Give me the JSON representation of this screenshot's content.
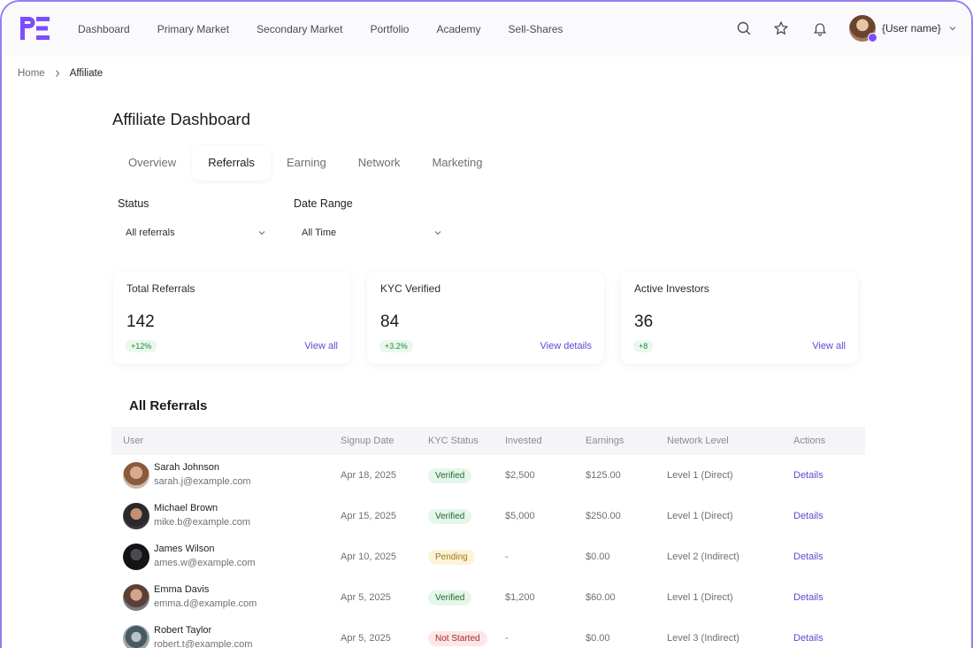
{
  "nav": {
    "items": [
      "Dashboard",
      "Primary Market",
      "Secondary Market",
      "Portfolio",
      "Academy",
      "Sell-Shares"
    ],
    "user_name": "{User name}",
    "icons": [
      "search-icon",
      "star-icon",
      "bell-icon"
    ]
  },
  "breadcrumb": {
    "home": "Home",
    "current": "Affiliate"
  },
  "page_title": "Affiliate Dashboard",
  "tabs": [
    "Overview",
    "Referrals",
    "Earning",
    "Network",
    "Marketing"
  ],
  "active_tab": "Referrals",
  "filters": {
    "status": {
      "label": "Status",
      "value": "All referrals"
    },
    "date_range": {
      "label": "Date Range",
      "value": "All Time"
    }
  },
  "stats": [
    {
      "label": "Total Referrals",
      "value": "142",
      "change": "+12%",
      "link": "View all"
    },
    {
      "label": "KYC Verified",
      "value": "84",
      "change": "+3.2%",
      "link": "View details"
    },
    {
      "label": "Active Investors",
      "value": "36",
      "change": "+8",
      "link": "View all"
    }
  ],
  "referrals": {
    "title": "All Referrals",
    "columns": [
      "User",
      "Signup Date",
      "KYC Status",
      "Invested",
      "Earnings",
      "Network Level",
      "Actions"
    ],
    "rows": [
      {
        "name": "Sarah Johnson",
        "email": "sarah.j@example.com",
        "date": "Apr 18, 2025",
        "kyc": "Verified",
        "invested": "$2,500",
        "earnings": "$125.00",
        "level": "Level 1 (Direct)",
        "action": "Details"
      },
      {
        "name": "Michael Brown",
        "email": "mike.b@example.com",
        "date": "Apr 15, 2025",
        "kyc": "Verified",
        "invested": "$5,000",
        "earnings": "$250.00",
        "level": "Level 1 (Direct)",
        "action": "Details"
      },
      {
        "name": "James Wilson",
        "email": "ames.w@example.com",
        "date": "Apr 10, 2025",
        "kyc": "Pending",
        "invested": "-",
        "earnings": "$0.00",
        "level": "Level 2 (Indirect)",
        "action": "Details"
      },
      {
        "name": "Emma Davis",
        "email": "emma.d@example.com",
        "date": "Apr 5, 2025",
        "kyc": "Verified",
        "invested": "$1,200",
        "earnings": "$60.00",
        "level": "Level 1 (Direct)",
        "action": "Details"
      },
      {
        "name": "Robert Taylor",
        "email": "robert.t@example.com",
        "date": "Apr 5, 2025",
        "kyc": "Not Started",
        "invested": "-",
        "earnings": "$0.00",
        "level": "Level 3 (Indirect)",
        "action": "Details"
      }
    ]
  },
  "colors": {
    "accent": "#7c4dff",
    "link": "#5a4bd1",
    "verified_bg": "#e6f7ea",
    "pending_bg": "#fdf3d9",
    "not_started_bg": "#fde6e6"
  }
}
